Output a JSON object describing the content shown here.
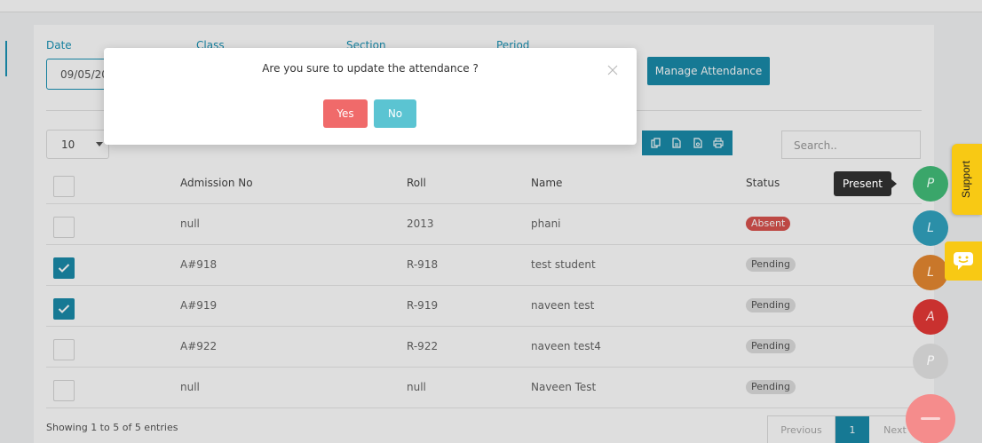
{
  "filters": {
    "date_label": "Date",
    "class_label": "Class",
    "section_label": "Section",
    "period_label": "Period",
    "date_value": "09/05/2023",
    "manage_button": "Manage Attendance"
  },
  "table_controls": {
    "page_length": "10",
    "search_placeholder": "Search..",
    "export_icons": [
      "copy-icon",
      "csv-icon",
      "pdf-icon",
      "print-icon"
    ]
  },
  "table": {
    "columns": [
      "Admission No",
      "Roll",
      "Name",
      "Status"
    ],
    "rows": [
      {
        "admission_no": "null",
        "roll": "2013",
        "name": "phani",
        "status": "Absent",
        "checked": false
      },
      {
        "admission_no": "A#918",
        "roll": "R-918",
        "name": "test student",
        "status": "Pending",
        "checked": true
      },
      {
        "admission_no": "A#919",
        "roll": "R-919",
        "name": "naveen test",
        "status": "Pending",
        "checked": true
      },
      {
        "admission_no": "A#922",
        "roll": "R-922",
        "name": "naveen test4",
        "status": "Pending",
        "checked": false
      },
      {
        "admission_no": "null",
        "roll": "null",
        "name": "Naveen Test",
        "status": "Pending",
        "checked": false
      }
    ]
  },
  "footer": {
    "info": "Showing 1 to 5 of 5 entries",
    "prev": "Previous",
    "current_page": "1",
    "next": "Next"
  },
  "modal": {
    "message": "Are you sure to update the attendance ?",
    "yes": "Yes",
    "no": "No"
  },
  "fab_menu": {
    "tooltip": "Present",
    "options": [
      {
        "letter": "P",
        "color": "#3aa66a"
      },
      {
        "letter": "L",
        "color": "#2b8fa8"
      },
      {
        "letter": "L",
        "color": "#c9772a"
      },
      {
        "letter": "A",
        "color": "#c9312f"
      },
      {
        "letter": "P",
        "color": "#c9c9c9"
      }
    ]
  },
  "support": {
    "label": "Support"
  },
  "colors": {
    "primary": "#1a8cab",
    "danger": "#d9534f",
    "yes_button": "#f06a6a",
    "no_button": "#5bc4d2",
    "support_yellow": "#f8c914"
  }
}
